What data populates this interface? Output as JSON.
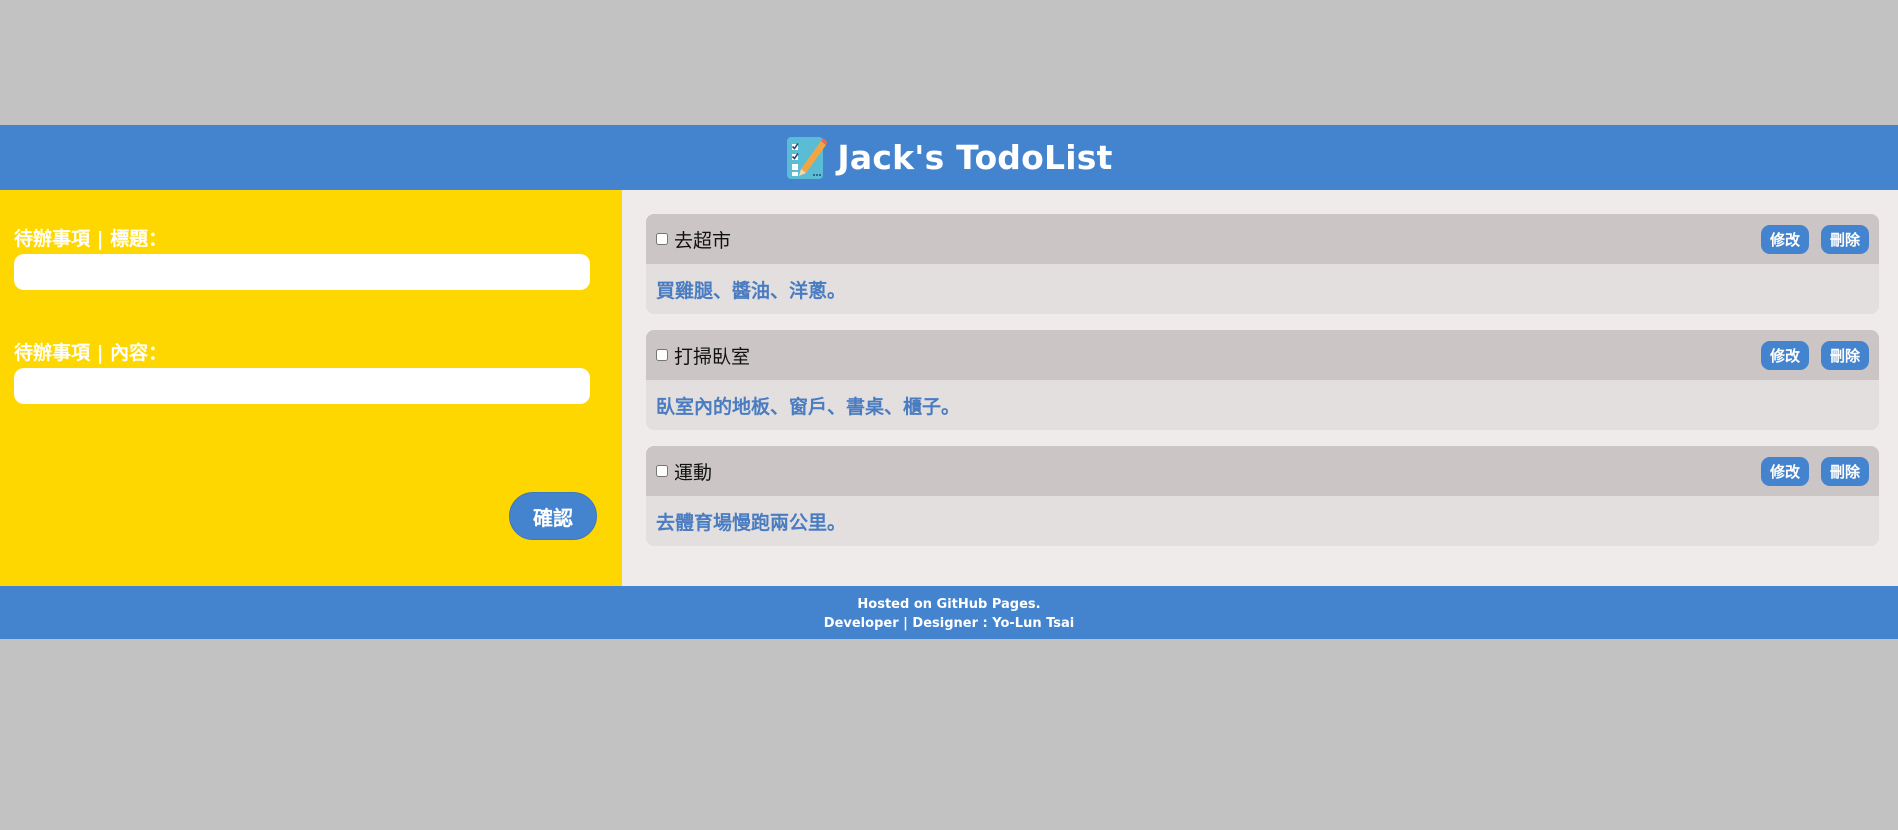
{
  "header": {
    "title": "Jack's TodoList",
    "logo_icon": "checklist-pencil-icon"
  },
  "form": {
    "title_label": "待辦事項 | 標題：",
    "title_value": "",
    "content_label": "待辦事項 | 內容：",
    "content_value": "",
    "confirm_label": "確認"
  },
  "todos": [
    {
      "title": "去超市",
      "content": "買雞腿、醬油、洋蔥。",
      "checked": false,
      "edit_label": "修改",
      "delete_label": "刪除"
    },
    {
      "title": "打掃臥室",
      "content": "臥室內的地板、窗戶、書桌、櫃子。",
      "checked": false,
      "edit_label": "修改",
      "delete_label": "刪除"
    },
    {
      "title": "運動",
      "content": "去體育場慢跑兩公里。",
      "checked": false,
      "edit_label": "修改",
      "delete_label": "刪除"
    }
  ],
  "footer": {
    "line1": "Hosted on GitHub Pages.",
    "line2": "Developer | Designer : Yo-Lun Tsai"
  },
  "colors": {
    "primary": "#4484ce",
    "form_bg": "#ffd700",
    "list_bg": "#efebeb",
    "card_head": "#cbc5c5",
    "card_body": "#e3dfdf",
    "content_text": "#4a7cc2"
  }
}
